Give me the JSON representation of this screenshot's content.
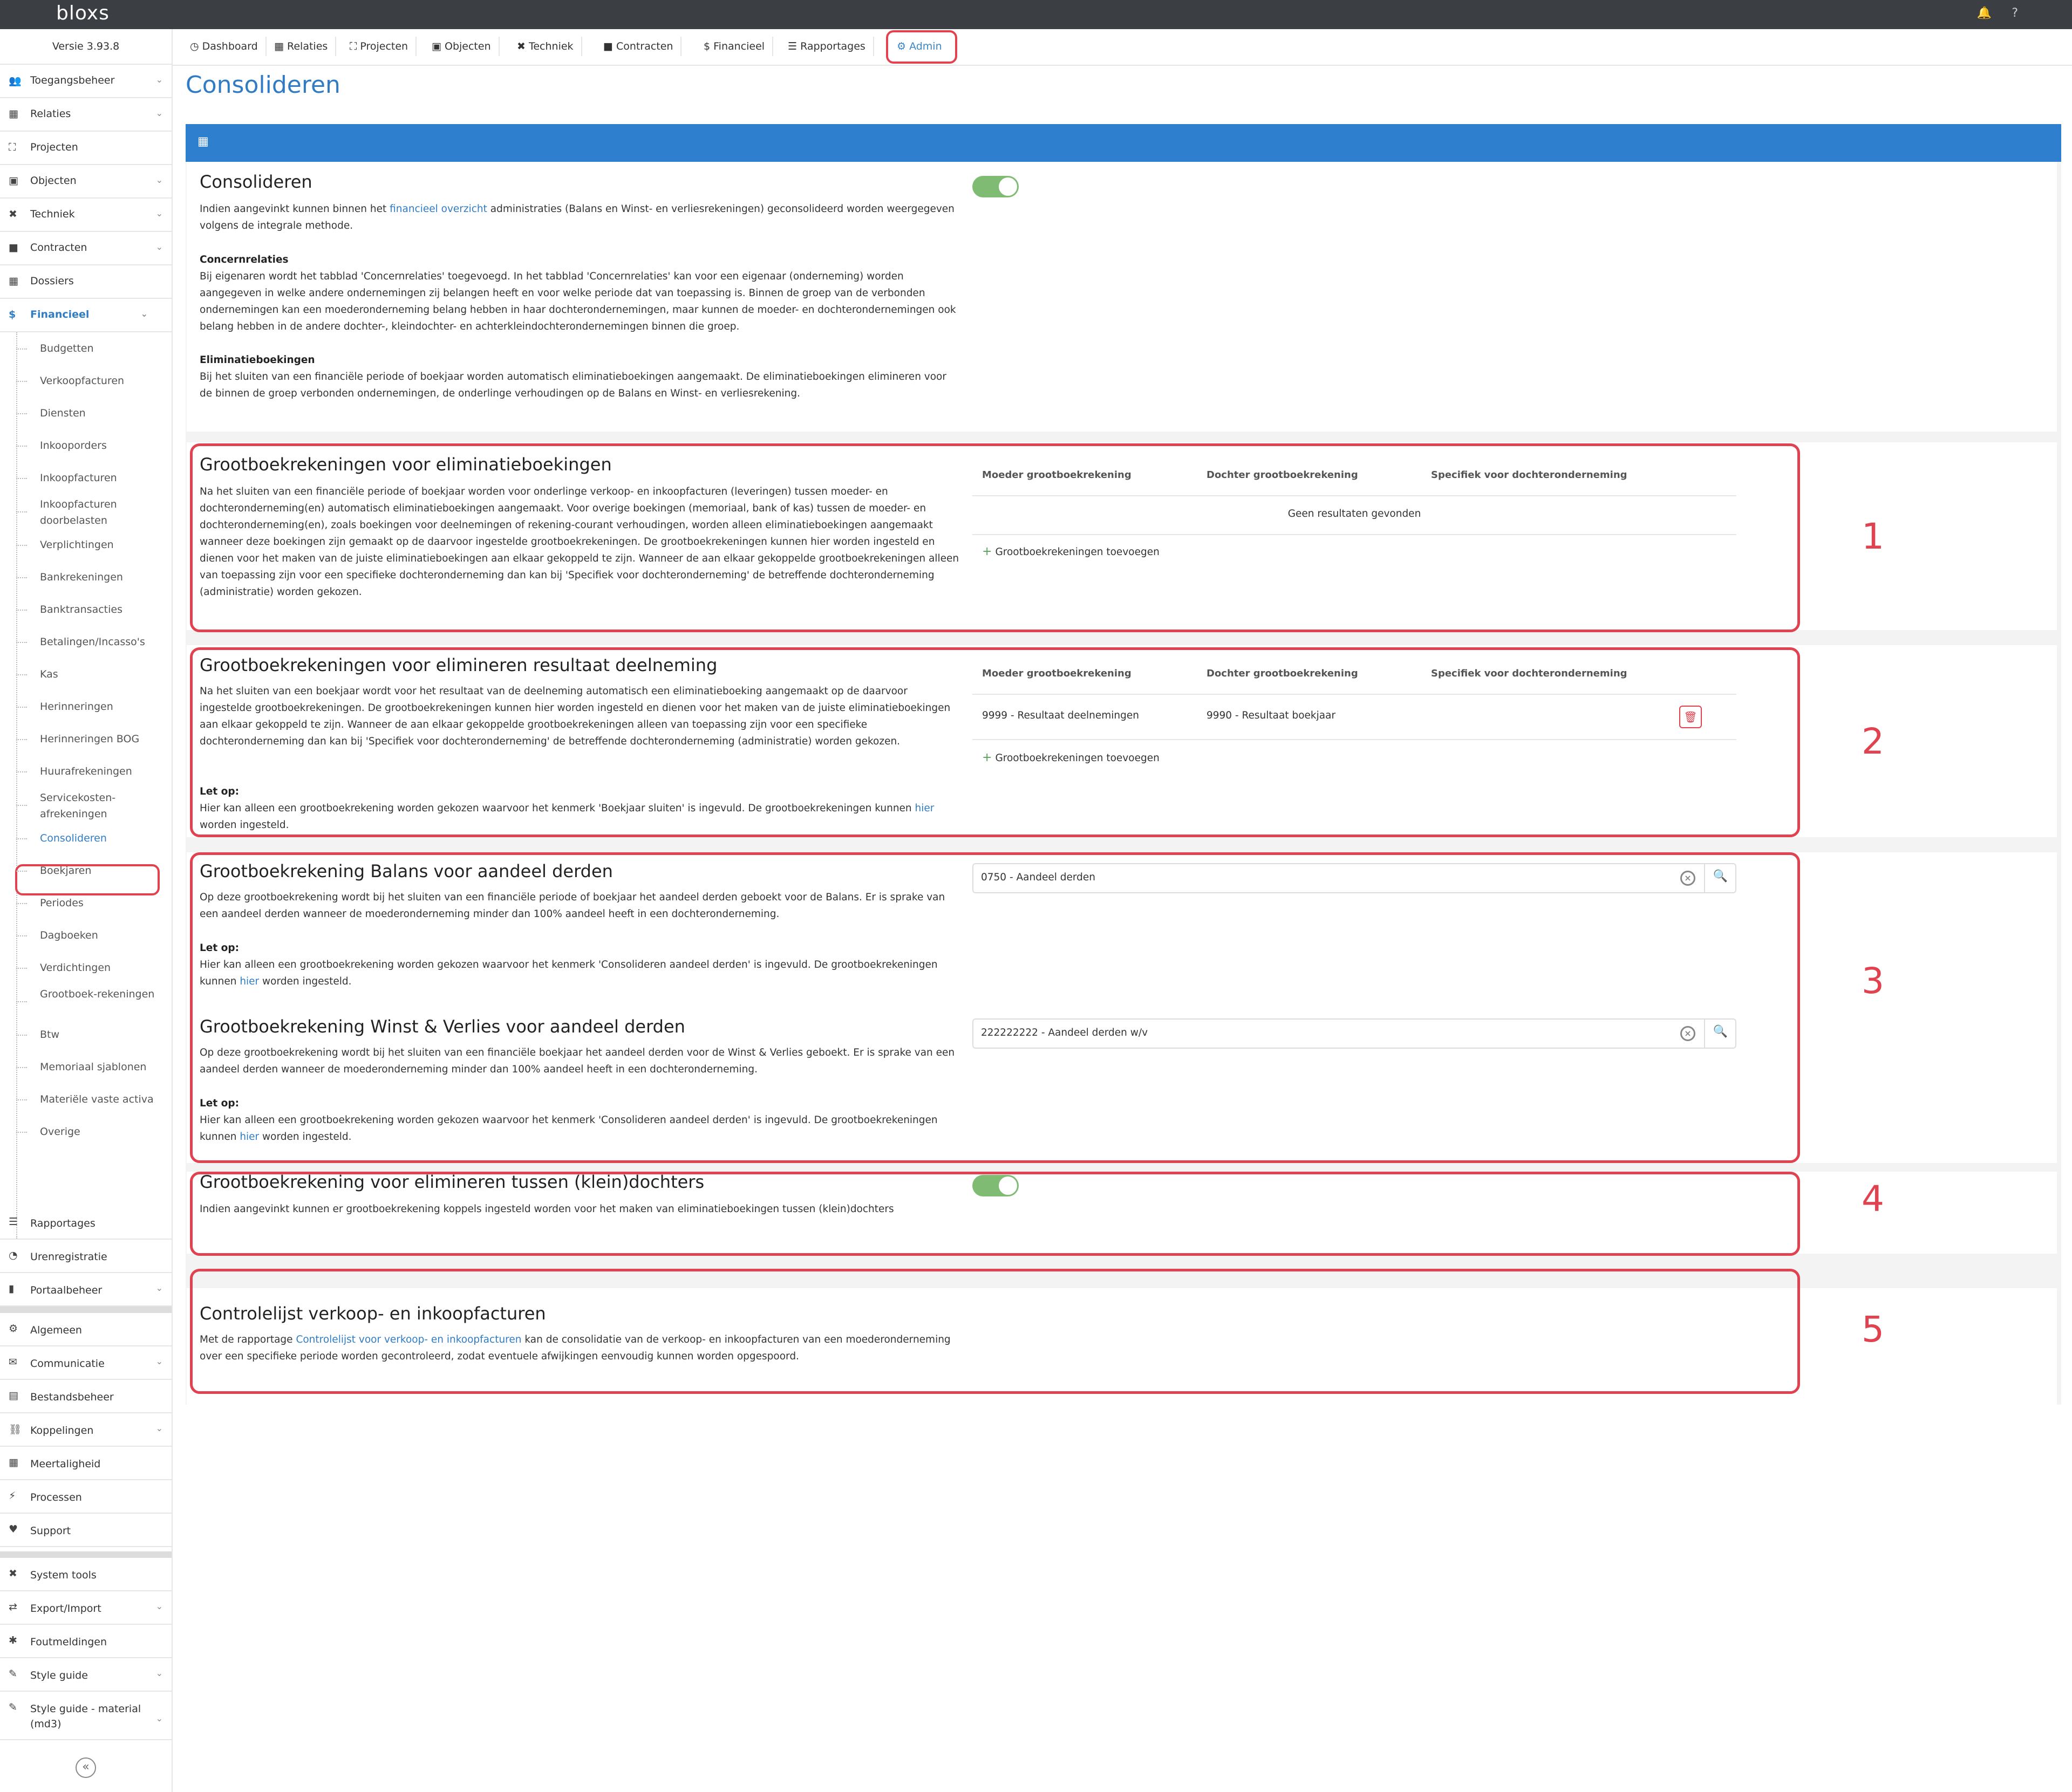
{
  "app": {
    "logo": "bloxs",
    "version": "Versie 3.93.8",
    "bell_icon": "bell-icon",
    "help": "?"
  },
  "sidebar": {
    "items": [
      {
        "label": "Toegangsbeheer",
        "icon": "users-icon",
        "chev": true
      },
      {
        "label": "Relaties",
        "icon": "sitemap-icon",
        "chev": true
      },
      {
        "label": "Projecten",
        "icon": "expand-icon",
        "chev": false
      },
      {
        "label": "Objecten",
        "icon": "image-icon",
        "chev": true
      },
      {
        "label": "Techniek",
        "icon": "tools-icon",
        "chev": true
      },
      {
        "label": "Contracten",
        "icon": "folder-icon",
        "chev": true
      },
      {
        "label": "Dossiers",
        "icon": "archive-icon",
        "chev": false
      },
      {
        "label": "Financieel",
        "icon": "dollar-icon",
        "chev": true
      }
    ],
    "financieel_sub": [
      "Budgetten",
      "Verkoopfacturen",
      "Diensten",
      "Inkooporders",
      "Inkoopfacturen",
      "Inkoopfacturen doorbelasten",
      "Verplichtingen",
      "Bankrekeningen",
      "Banktransacties",
      "Betalingen/Incasso's",
      "Kas",
      "Herinneringen",
      "Herinneringen BOG",
      "Huurafrekeningen",
      "Servicekosten-afrekeningen",
      "Consolideren",
      "Boekjaren",
      "Periodes",
      "Dagboeken",
      "Verdichtingen",
      "Grootboek-rekeningen",
      "Btw",
      "Memoriaal sjablonen",
      "Materiële vaste activa",
      "Overige"
    ],
    "bottom_items_1": [
      {
        "label": "Rapportages",
        "icon": "list-icon",
        "chev": false
      },
      {
        "label": "Urenregistratie",
        "icon": "clock-icon",
        "chev": false
      },
      {
        "label": "Portaalbeheer",
        "icon": "bookmark-icon",
        "chev": true
      }
    ],
    "bottom_items_2": [
      {
        "label": "Algemeen",
        "icon": "gear-icon",
        "chev": false
      },
      {
        "label": "Communicatie",
        "icon": "envelope-icon",
        "chev": true
      },
      {
        "label": "Bestandsbeheer",
        "icon": "file-icon",
        "chev": false
      },
      {
        "label": "Koppelingen",
        "icon": "link-icon",
        "chev": true
      },
      {
        "label": "Meertaligheid",
        "icon": "language-icon",
        "chev": false
      },
      {
        "label": "Processen",
        "icon": "bolt-icon",
        "chev": false
      },
      {
        "label": "Support",
        "icon": "heart-icon",
        "chev": false
      }
    ],
    "bottom_items_3": [
      {
        "label": "System tools",
        "icon": "tools-icon",
        "chev": false
      },
      {
        "label": "Export/Import",
        "icon": "exchange-icon",
        "chev": true
      },
      {
        "label": "Foutmeldingen",
        "icon": "bug-icon",
        "chev": false
      },
      {
        "label": "Style guide",
        "icon": "brush-icon",
        "chev": true
      },
      {
        "label": "Style guide - material (md3)",
        "icon": "brush-icon",
        "chev": true
      }
    ]
  },
  "tabs": [
    {
      "label": "Dashboard",
      "icon": "dashboard-icon"
    },
    {
      "label": "Relaties",
      "icon": "sitemap-icon"
    },
    {
      "label": "Projecten",
      "icon": "expand-icon"
    },
    {
      "label": "Objecten",
      "icon": "image-icon"
    },
    {
      "label": "Techniek",
      "icon": "tools-icon"
    },
    {
      "label": "Contracten",
      "icon": "folder-icon"
    },
    {
      "label": "Financieel",
      "icon": "dollar-icon"
    },
    {
      "label": "Rapportages",
      "icon": "list-icon"
    },
    {
      "label": "Admin",
      "icon": "gear-icon"
    }
  ],
  "page": {
    "title": "Consolideren",
    "header_icon": "sitemap-icon"
  },
  "sections": {
    "consolideren": {
      "title": "Consolideren",
      "text_pre": "Indien aangevinkt kunnen binnen het ",
      "link": "financieel overzicht",
      "text_post": " administraties (Balans en Winst- en verliesrekeningen) geconsolideerd worden weergegeven volgens de integrale methode.",
      "concern_heading": "Concernrelaties",
      "concern_text": "Bij eigenaren wordt het tabblad 'Concernrelaties' toegevoegd. In het tabblad 'Concernrelaties' kan voor een eigenaar (onderneming) worden aangegeven in welke andere ondernemingen zij belangen heeft en voor welke periode dat van toepassing is. Binnen de groep van de verbonden ondernemingen kan een moederonderneming belang hebben in haar dochterondernemingen, maar kunnen de moeder- en dochterondernemingen ook belang hebben in de andere dochter-, kleindochter- en achterkleindochterondernemingen binnen die groep.",
      "elim_heading": "Eliminatieboekingen",
      "elim_text": "Bij het sluiten van een financiële periode of boekjaar worden automatisch eliminatieboekingen aangemaakt. De eliminatieboekingen elimineren voor de binnen de groep verbonden ondernemingen, de onderlinge verhoudingen op de Balans en Winst- en verliesrekening.",
      "toggle_on": true
    },
    "s1": {
      "title": "Grootboekrekeningen voor eliminatieboekingen",
      "text": "Na het sluiten van een financiële periode of boekjaar worden voor onderlinge verkoop- en inkoopfacturen (leveringen) tussen moeder- en dochteronderneming(en) automatisch eliminatieboekingen aangemaakt. Voor overige boekingen (memoriaal, bank of kas) tussen de moeder- en dochteronderneming(en), zoals boekingen voor deelnemingen of rekening-courant verhoudingen, worden alleen eliminatieboekingen aangemaakt wanneer deze boekingen zijn gemaakt op de daarvoor ingestelde grootboekrekeningen. De grootboekrekeningen kunnen hier worden ingesteld en dienen voor het maken van de juiste eliminatieboekingen aan elkaar gekoppeld te zijn. Wanneer de aan elkaar gekoppelde grootboekrekeningen alleen van toepassing zijn voor een specifieke dochteronderneming dan kan bij 'Specifiek voor dochteronderneming' de betreffende dochteronderneming (administratie) worden gekozen.",
      "col1": "Moeder grootboekrekening",
      "col2": "Dochter grootboekrekening",
      "col3": "Specifiek voor dochteronderneming",
      "empty": "Geen resultaten gevonden",
      "add": "Grootboekrekeningen toevoegen",
      "number": "1"
    },
    "s2": {
      "title": "Grootboekrekeningen voor elimineren resultaat deelneming",
      "text": "Na het sluiten van een boekjaar wordt voor het resultaat van de deelneming automatisch een eliminatieboeking aangemaakt op de daarvoor ingestelde grootboekrekeningen. De grootboekrekeningen kunnen hier worden ingesteld en dienen voor het maken van de juiste eliminatieboekingen aan elkaar gekoppeld te zijn. Wanneer de aan elkaar gekoppelde grootboekrekeningen alleen van toepassing zijn voor een specifieke dochteronderneming dan kan bij 'Specifiek voor dochteronderneming' de betreffende dochteronderneming (administratie) worden gekozen.",
      "note_heading": "Let op:",
      "note_text": "Hier kan alleen een grootboekrekening worden gekozen waarvoor het kenmerk 'Boekjaar sluiten' is ingevuld. De grootboekrekeningen kunnen ",
      "note_link": "hier",
      "note_post": " worden ingesteld.",
      "col1": "Moeder grootboekrekening",
      "col2": "Dochter grootboekrekening",
      "col3": "Specifiek voor dochteronderneming",
      "row_moeder": "9999 - Resultaat deelnemingen",
      "row_dochter": "9990 - Resultaat boekjaar",
      "add": "Grootboekrekeningen toevoegen",
      "number": "2"
    },
    "s3a": {
      "title": "Grootboekrekening Balans voor aandeel derden",
      "text": "Op deze grootboekrekening wordt bij het sluiten van een financiële periode of boekjaar het aandeel derden geboekt voor de Balans. Er is sprake van een aandeel derden wanneer de moederonderneming minder dan 100% aandeel heeft in een dochteronderneming.",
      "note_heading": "Let op:",
      "note_text": "Hier kan alleen een grootboekrekening worden gekozen waarvoor het kenmerk 'Consolideren aandeel derden' is ingevuld. De grootboekrekeningen kunnen ",
      "note_link": "hier",
      "note_post": " worden ingesteld.",
      "value": "0750 - Aandeel derden",
      "number": "3"
    },
    "s3b": {
      "title": "Grootboekrekening Winst & Verlies voor aandeel derden",
      "text": "Op deze grootboekrekening wordt bij het sluiten van een financiële boekjaar het aandeel derden voor de Winst & Verlies geboekt. Er is sprake van een aandeel derden wanneer de moederonderneming minder dan 100% aandeel heeft in een dochteronderneming.",
      "note_heading": "Let op:",
      "note_text": "Hier kan alleen een grootboekrekening worden gekozen waarvoor het kenmerk 'Consolideren aandeel derden' is ingevuld. De grootboekrekeningen kunnen ",
      "note_link": "hier",
      "note_post": " worden ingesteld.",
      "value": "222222222 - Aandeel derden w/v"
    },
    "s4": {
      "title": "Grootboekrekening voor elimineren tussen (klein)dochters",
      "text": "Indien aangevinkt kunnen er grootboekrekening koppels ingesteld worden voor het maken van eliminatieboekingen tussen (klein)dochters",
      "toggle_on": true,
      "number": "4"
    },
    "s5": {
      "title": "Controlelijst verkoop- en inkoopfacturen",
      "text_pre": "Met de rapportage ",
      "link": "Controlelijst voor verkoop- en inkoopfacturen",
      "text_post": " kan de consolidatie van de verkoop- en inkoopfacturen van een moederonderneming over een specifieke periode worden gecontroleerd, zodat eventuele afwijkingen eenvoudig kunnen worden opgespoord.",
      "number": "5"
    }
  },
  "colors": {
    "accent": "#2f7cc4",
    "header_bar": "#2f7fcf",
    "highlight_red": "#e0424f",
    "toggle_green": "#7fbb73"
  }
}
